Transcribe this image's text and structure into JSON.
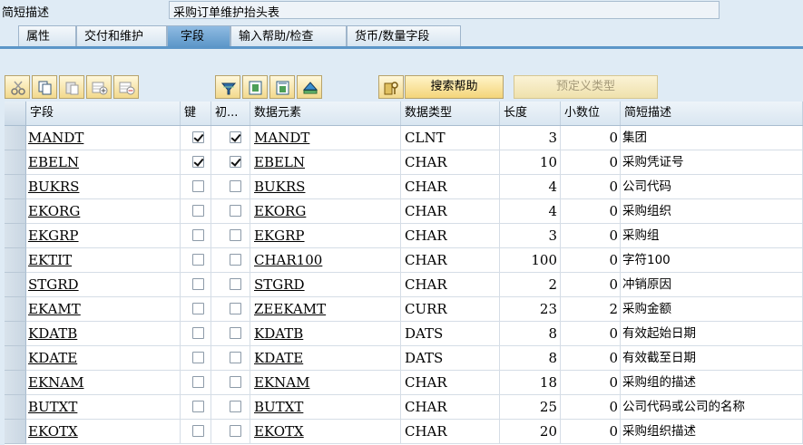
{
  "header": {
    "label": "简短描述",
    "value": "采购订单维护抬头表"
  },
  "tabs": [
    {
      "label": "属性",
      "active": false
    },
    {
      "label": "交付和维护",
      "active": false
    },
    {
      "label": "字段",
      "active": true
    },
    {
      "label": "输入帮助/检查",
      "active": false
    },
    {
      "label": "货币/数量字段",
      "active": false
    }
  ],
  "toolbar": {
    "icons": [
      "cut-icon",
      "copy-icon",
      "paste-icon",
      "insert-row-icon",
      "delete-row-icon",
      "filter-icon",
      "first-page-icon",
      "last-page-icon",
      "find-icon",
      "search-help-key-icon"
    ],
    "search_help_label": "搜索帮助",
    "predefined_type_label": "预定义类型"
  },
  "table": {
    "columns": [
      "字段",
      "键",
      "初...",
      "数据元素",
      "数据类型",
      "长度",
      "小数位",
      "简短描述"
    ],
    "rows": [
      {
        "field": "MANDT",
        "key": true,
        "init": true,
        "element": "MANDT",
        "type": "CLNT",
        "length": "3",
        "decimals": "0",
        "desc": "集团"
      },
      {
        "field": "EBELN",
        "key": true,
        "init": true,
        "element": "EBELN",
        "type": "CHAR",
        "length": "10",
        "decimals": "0",
        "desc": "采购凭证号"
      },
      {
        "field": "BUKRS",
        "key": false,
        "init": false,
        "element": "BUKRS",
        "type": "CHAR",
        "length": "4",
        "decimals": "0",
        "desc": "公司代码"
      },
      {
        "field": "EKORG",
        "key": false,
        "init": false,
        "element": "EKORG",
        "type": "CHAR",
        "length": "4",
        "decimals": "0",
        "desc": "采购组织"
      },
      {
        "field": "EKGRP",
        "key": false,
        "init": false,
        "element": "EKGRP",
        "type": "CHAR",
        "length": "3",
        "decimals": "0",
        "desc": "采购组"
      },
      {
        "field": "EKTIT",
        "key": false,
        "init": false,
        "element": "CHAR100",
        "type": "CHAR",
        "length": "100",
        "decimals": "0",
        "desc": "字符100"
      },
      {
        "field": "STGRD",
        "key": false,
        "init": false,
        "element": "STGRD",
        "type": "CHAR",
        "length": "2",
        "decimals": "0",
        "desc": "冲销原因"
      },
      {
        "field": "EKAMT",
        "key": false,
        "init": false,
        "element": "ZEEKAMT",
        "type": "CURR",
        "length": "23",
        "decimals": "2",
        "desc": "采购金额"
      },
      {
        "field": "KDATB",
        "key": false,
        "init": false,
        "element": "KDATB",
        "type": "DATS",
        "length": "8",
        "decimals": "0",
        "desc": "有效起始日期"
      },
      {
        "field": "KDATE",
        "key": false,
        "init": false,
        "element": "KDATE",
        "type": "DATS",
        "length": "8",
        "decimals": "0",
        "desc": "有效截至日期"
      },
      {
        "field": "EKNAM",
        "key": false,
        "init": false,
        "element": "EKNAM",
        "type": "CHAR",
        "length": "18",
        "decimals": "0",
        "desc": "采购组的描述"
      },
      {
        "field": "BUTXT",
        "key": false,
        "init": false,
        "element": "BUTXT",
        "type": "CHAR",
        "length": "25",
        "decimals": "0",
        "desc": "公司代码或公司的名称"
      },
      {
        "field": "EKOTX",
        "key": false,
        "init": false,
        "element": "EKOTX",
        "type": "CHAR",
        "length": "20",
        "decimals": "0",
        "desc": "采购组织描述"
      }
    ]
  }
}
